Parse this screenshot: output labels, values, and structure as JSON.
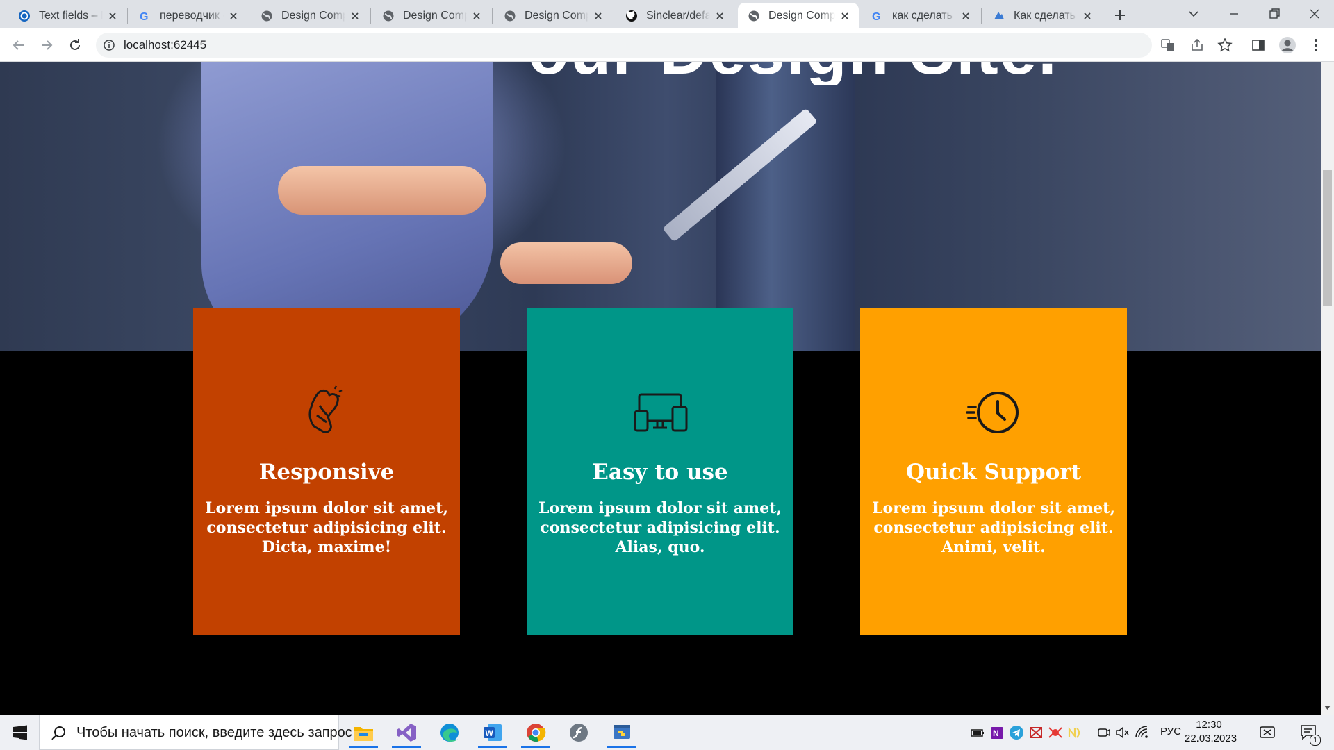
{
  "browser": {
    "tabs": [
      {
        "title": "Text fields – Material",
        "icon": "material-icon",
        "active": false
      },
      {
        "title": "переводчик - Поиск",
        "icon": "google-icon",
        "active": false
      },
      {
        "title": "Design Company",
        "icon": "globe-icon",
        "active": false
      },
      {
        "title": "Design Company",
        "icon": "globe-icon",
        "active": false
      },
      {
        "title": "Design Company",
        "icon": "globe-icon",
        "active": false
      },
      {
        "title": "Sinclear/default",
        "icon": "github-icon",
        "active": false
      },
      {
        "title": "Design Company",
        "icon": "globe-icon",
        "active": true
      },
      {
        "title": "как сделать скролл",
        "icon": "google-icon",
        "active": false
      },
      {
        "title": "Как сделать скролл",
        "icon": "web-icon",
        "active": false
      }
    ],
    "url": "localhost:62445"
  },
  "page": {
    "headline": "our Design Site.",
    "cards": [
      {
        "title": "Responsive",
        "text": "Lorem ipsum dolor sit amet, consectetur adipisicing elit. Dicta, maxime!",
        "color": "#c24100",
        "icon": "heart-hand-icon"
      },
      {
        "title": "Easy to use",
        "text": "Lorem ipsum dolor sit amet, consectetur adipisicing elit. Alias, quo.",
        "color": "#009688",
        "icon": "devices-icon"
      },
      {
        "title": "Quick Support",
        "text": "Lorem ipsum dolor sit amet, consectetur adipisicing elit. Animi, velit.",
        "color": "#ffa000",
        "icon": "clock-icon"
      }
    ]
  },
  "taskbar": {
    "search_placeholder": "Чтобы начать поиск, введите здесь запрос",
    "language": "РУС",
    "time": "12:30",
    "date": "22.03.2023",
    "notifications": "1"
  }
}
